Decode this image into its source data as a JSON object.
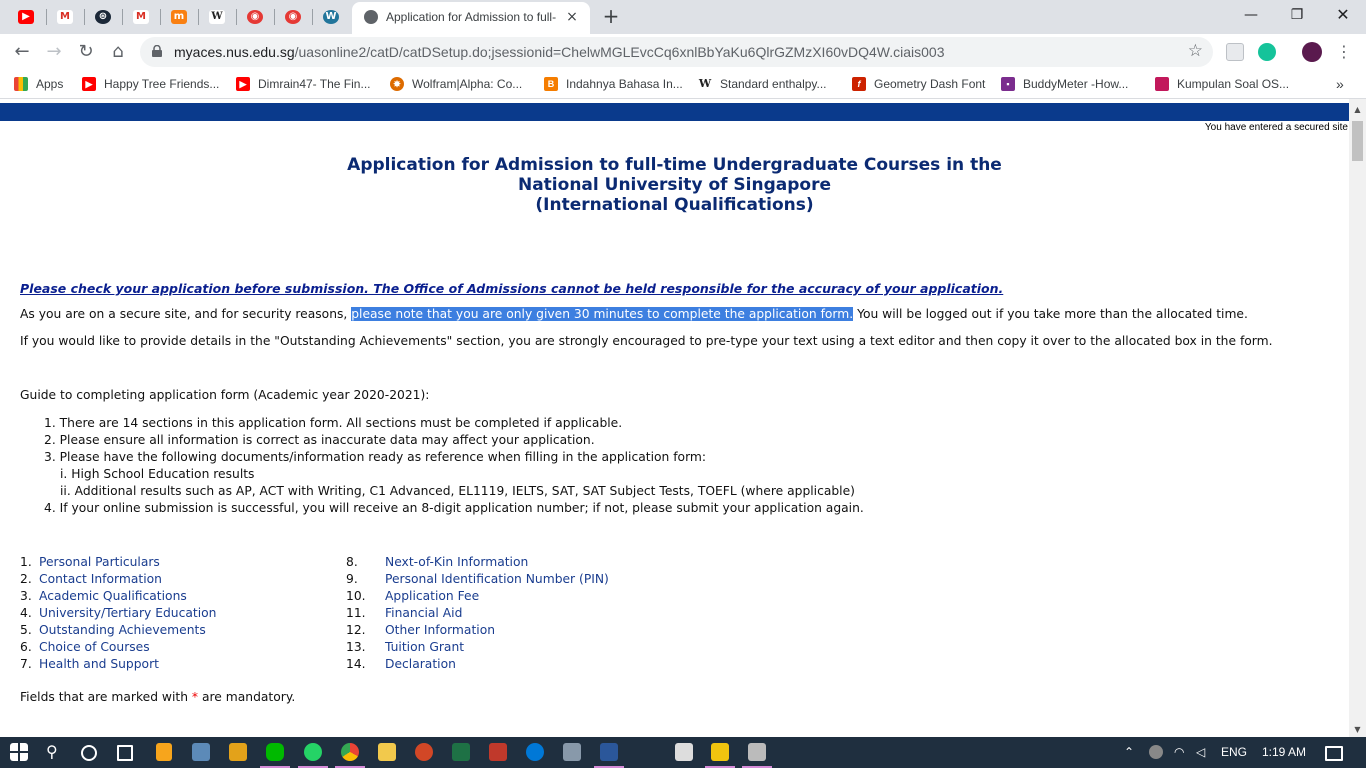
{
  "browser": {
    "active_tab_title": "Application for Admission to full-",
    "tab_close": "×",
    "new_tab": "+",
    "url_host": "myaces.nus.edu.sg",
    "url_path": "/uasonline2/catD/catDSetup.do;jsessionid=ChelwMGLEvcCq6xnlBbYaKu6QlrGZMzXI60vDQ4W.ciais003",
    "window_controls": {
      "minimize": "—",
      "restore": "❐",
      "close": "✕"
    },
    "pinned_tabs": [
      {
        "icon": "youtube-icon",
        "glyph": "▶",
        "color": "#ff0000"
      },
      {
        "icon": "gmail-icon",
        "glyph": "M",
        "color": "#d93025"
      },
      {
        "icon": "steam-icon",
        "glyph": "⊛",
        "color": "#1b2838"
      },
      {
        "icon": "gmail-icon",
        "glyph": "M",
        "color": "#d93025"
      },
      {
        "icon": "moodle-icon",
        "glyph": "m",
        "color": "#f98012"
      },
      {
        "icon": "wikipedia-icon",
        "glyph": "W",
        "color": "#ffffff"
      },
      {
        "icon": "app-icon",
        "glyph": "◉",
        "color": "#e53935"
      },
      {
        "icon": "app-icon",
        "glyph": "◉",
        "color": "#e53935"
      },
      {
        "icon": "wordpress-icon",
        "glyph": "W",
        "color": "#21759b"
      }
    ],
    "bookmarks": [
      {
        "label": "Apps",
        "icon": "apps-grid-icon",
        "color": "#4285f4"
      },
      {
        "label": "Happy Tree Friends...",
        "icon": "youtube-icon",
        "color": "#ff0000"
      },
      {
        "label": "Dimrain47- The Fin...",
        "icon": "youtube-icon",
        "color": "#ff0000"
      },
      {
        "label": "Wolfram|Alpha: Co...",
        "icon": "wolfram-icon",
        "color": "#dd6b00"
      },
      {
        "label": "Indahnya Bahasa In...",
        "icon": "blogger-icon",
        "color": "#f57d00"
      },
      {
        "label": "Standard enthalpy...",
        "icon": "wikipedia-icon",
        "color": "#222222"
      },
      {
        "label": "Geometry Dash Font",
        "icon": "font-icon",
        "color": "#cc2200"
      },
      {
        "label": "BuddyMeter -How...",
        "icon": "buddymeter-icon",
        "color": "#7b2d8e"
      },
      {
        "label": "Kumpulan Soal OS...",
        "icon": "bookmark-site-icon",
        "color": "#c2185b"
      }
    ],
    "bookmarks_more": "»"
  },
  "page": {
    "secure_note": "You have entered a secured site",
    "title_line1": "Application for Admission to full-time Undergraduate Courses in the",
    "title_line2": "National University of Singapore",
    "title_line3": "(International Qualifications)",
    "warning": "Please check your application before submission. The Office of Admissions cannot be held responsible for the accuracy of your application.",
    "security_pre": "As you are on a secure site, and for security reasons, ",
    "security_highlight": "please note that you are only given 30 minutes to complete the application form.",
    "security_post": " You will be logged out if you take more than the allocated time.",
    "achievements_note": "If you would like to provide details in the \"Outstanding Achievements\" section, you are strongly encouraged to pre-type your text using a text editor and then copy it over to the allocated box in the form.",
    "guide_heading": "Guide to completing application form (Academic year 2020-2021):",
    "guide_items": [
      "1. There are 14 sections in this application form. All sections must be completed if applicable.",
      "2. Please ensure all information is correct as inaccurate data may affect your application.",
      "3. Please have the following documents/information ready as reference when filling in the application form:",
      "i. High School Education results",
      "ii. Additional results such as AP, ACT with Writing, C1 Advanced, EL1119, IELTS, SAT, SAT Subject Tests, TOEFL (where applicable)",
      "4. If your online submission is successful, you will receive an 8-digit application number; if not, please submit your application again."
    ],
    "sections_left": [
      {
        "num": "1.",
        "label": "Personal Particulars"
      },
      {
        "num": "2.",
        "label": "Contact Information"
      },
      {
        "num": "3.",
        "label": "Academic Qualifications"
      },
      {
        "num": "4.",
        "label": "University/Tertiary Education"
      },
      {
        "num": "5.",
        "label": "Outstanding Achievements"
      },
      {
        "num": "6.",
        "label": "Choice of Courses"
      },
      {
        "num": "7.",
        "label": "Health and Support"
      }
    ],
    "sections_right": [
      {
        "num": "8.",
        "label": "Next-of-Kin Information"
      },
      {
        "num": "9.",
        "label": "Personal Identification Number (PIN)"
      },
      {
        "num": "10.",
        "label": "Application Fee"
      },
      {
        "num": "11.",
        "label": "Financial Aid"
      },
      {
        "num": "12.",
        "label": "Other Information"
      },
      {
        "num": "13.",
        "label": "Tuition Grant"
      },
      {
        "num": "14.",
        "label": "Declaration"
      }
    ],
    "mandatory_pre": "Fields that are marked with ",
    "mandatory_star": "*",
    "mandatory_post": " are mandatory."
  },
  "taskbar": {
    "language": "ENG",
    "time": "1:19 AM"
  }
}
